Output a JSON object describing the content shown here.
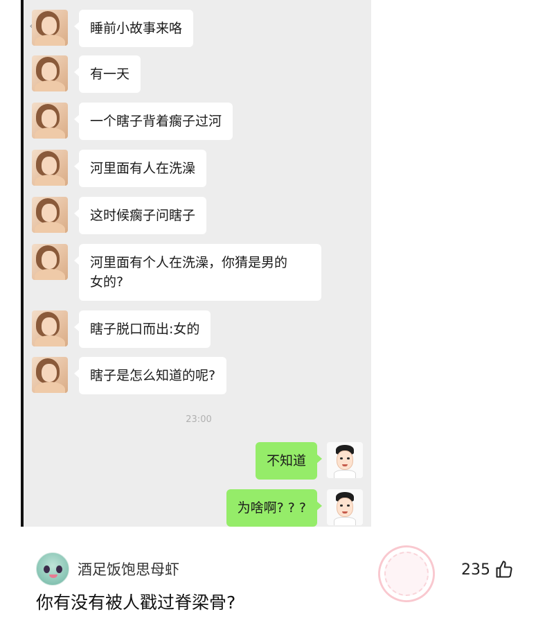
{
  "chat": {
    "incoming_messages": [
      {
        "text": "睡前小故事来咯"
      },
      {
        "text": "有一天"
      },
      {
        "text": "一个瞎子背着瘸子过河"
      },
      {
        "text": "河里面有人在洗澡"
      },
      {
        "text": "这时候瘸子问瞎子"
      },
      {
        "text": "河里面有个人在洗澡，你猜是男的\n女的?"
      },
      {
        "text": "瞎子脱口而出:女的"
      },
      {
        "text": "瞎子是怎么知道的呢?"
      }
    ],
    "timestamp": "23:00",
    "outgoing_messages": [
      {
        "text": "不知道"
      },
      {
        "text": "为啥啊? ? ?"
      }
    ],
    "colors": {
      "incoming_bubble": "#ffffff",
      "outgoing_bubble": "#95ec69",
      "chat_background": "#ededed"
    }
  },
  "comment": {
    "username": "酒足饭饱思母虾",
    "text": "你有没有被人戳过脊梁骨?",
    "like_count": "235"
  },
  "icons": {
    "back": "chevron-left-icon",
    "like": "thumbs-up-icon",
    "watermark": "stamp-watermark-icon"
  }
}
